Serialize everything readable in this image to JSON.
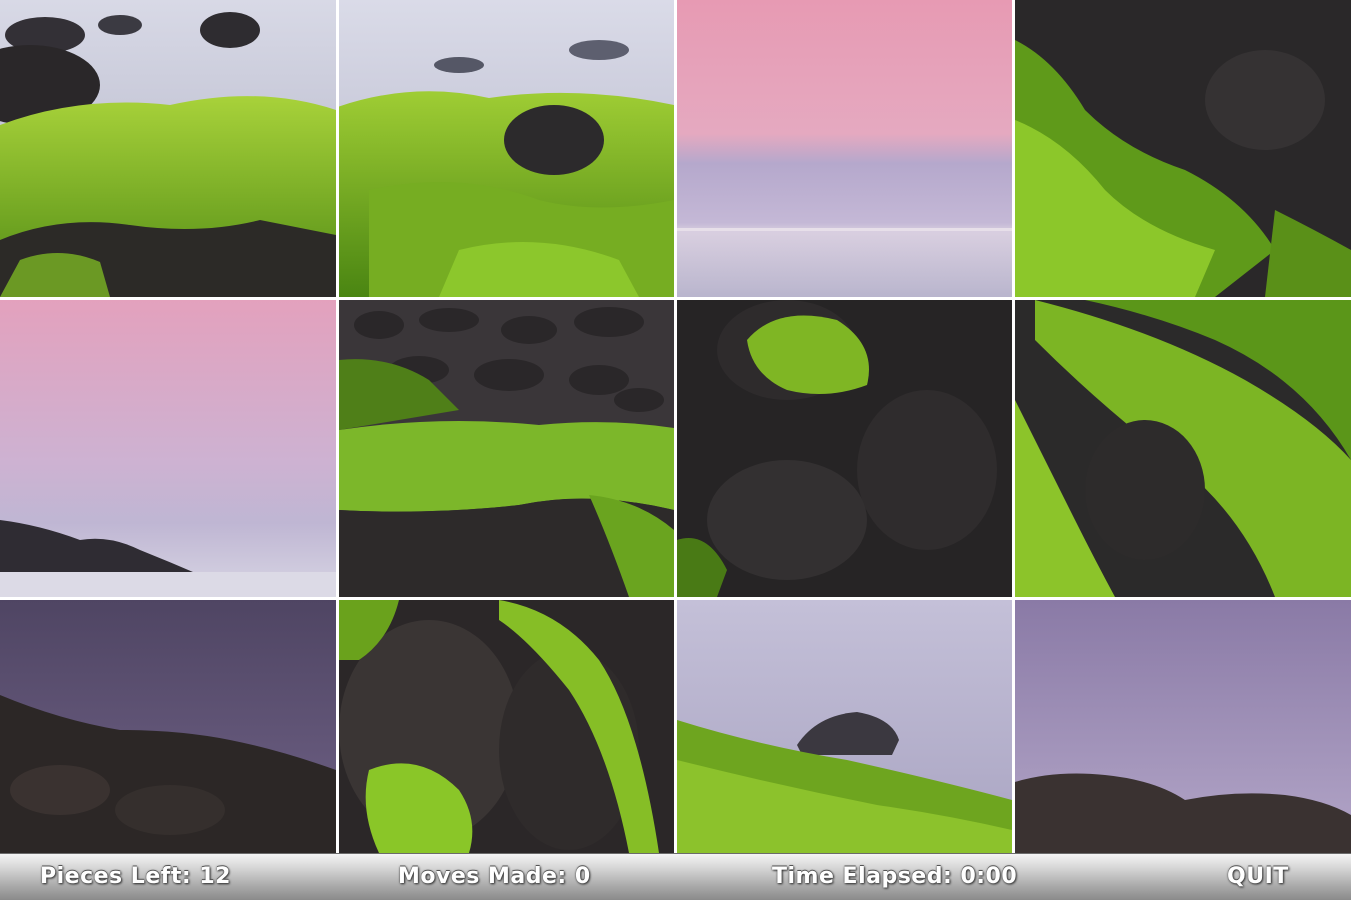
{
  "status_bar": {
    "pieces_left_label": "Pieces Left:",
    "pieces_left_value": "12",
    "moves_made_label": "Moves Made:",
    "moves_made_value": "0",
    "time_elapsed_label": "Time Elapsed:",
    "time_elapsed_value": "0:00",
    "quit_label": "QUIT"
  },
  "puzzle": {
    "rows": 3,
    "cols": 4,
    "tiles": [
      {
        "name": "tile-r1c1",
        "scene": "moss-rocks-mist-foreground",
        "colors": [
          "#c9c9d8",
          "#7fb020"
        ]
      },
      {
        "name": "tile-r1c2",
        "scene": "moss-rocks-mist-foreground",
        "colors": [
          "#c9c9d8",
          "#7fb020"
        ]
      },
      {
        "name": "tile-r1c3",
        "scene": "pink-sky-sea-horizon",
        "colors": [
          "#e8a8bb",
          "#b7a9c9"
        ]
      },
      {
        "name": "tile-r1c4",
        "scene": "dark-rock-green-moss",
        "colors": [
          "#2b2a2a",
          "#6aa01e"
        ]
      },
      {
        "name": "tile-r2c1",
        "scene": "pink-sky-rocks-misty-sea",
        "colors": [
          "#e0a3bd",
          "#c4bbd3"
        ]
      },
      {
        "name": "tile-r2c2",
        "scene": "pebbles-and-moss",
        "colors": [
          "#3a3638",
          "#86b728"
        ]
      },
      {
        "name": "tile-r2c3",
        "scene": "dark-rock-moss-clump",
        "colors": [
          "#262526",
          "#72ab1f"
        ]
      },
      {
        "name": "tile-r2c4",
        "scene": "moss-over-dark-rock",
        "colors": [
          "#2b2a2a",
          "#8dc22b"
        ]
      },
      {
        "name": "tile-r3c1",
        "scene": "purple-sky-dark-cliff",
        "colors": [
          "#5e5174",
          "#2c2726"
        ]
      },
      {
        "name": "tile-r3c2",
        "scene": "boulders-with-moss",
        "colors": [
          "#2f2b2c",
          "#80bb24"
        ]
      },
      {
        "name": "tile-r3c3",
        "scene": "mist-rock-moss",
        "colors": [
          "#b9b4ce",
          "#6ea51f"
        ]
      },
      {
        "name": "tile-r3c4",
        "scene": "purple-sky-low-cliff",
        "colors": [
          "#9c8bb6",
          "#3a3231"
        ]
      }
    ]
  }
}
